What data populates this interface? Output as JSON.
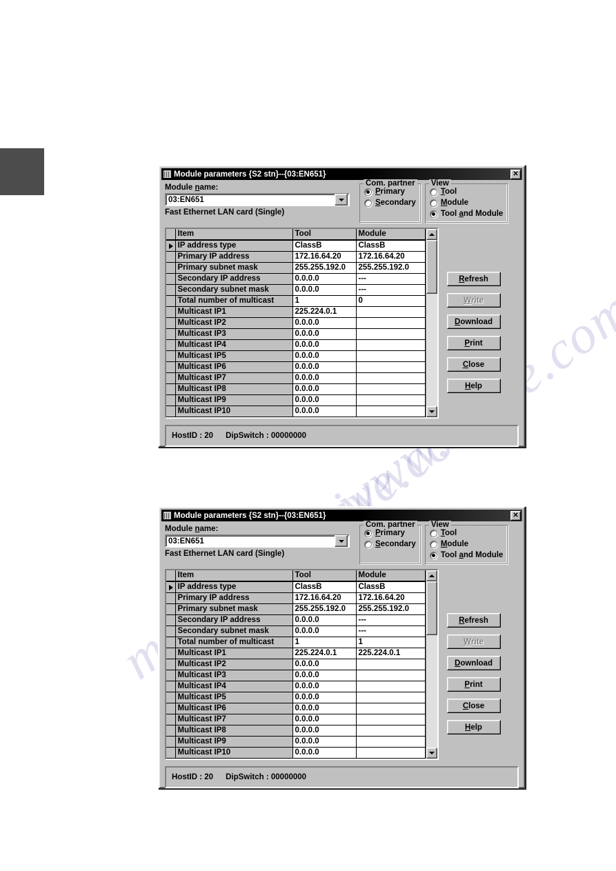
{
  "dialogs": [
    {
      "title": "Module parameters {S2 stn}--{03:EN651}",
      "close_label": "✕",
      "module_name_label": "Module name:",
      "module_name_value": "03:EN651",
      "module_caption": "Fast Ethernet LAN card (Single)",
      "com_partner": {
        "title": "Com. partner",
        "options": [
          "Primary",
          "Secondary"
        ],
        "selected": "Primary"
      },
      "view": {
        "title": "View",
        "options": [
          "Tool",
          "Module",
          "Tool and Module"
        ],
        "selected": "Tool and Module"
      },
      "grid": {
        "columns": [
          "Item",
          "Tool",
          "Module"
        ],
        "selected_row": 0,
        "rows": [
          {
            "item": "IP address type",
            "tool": "ClassB",
            "module": "ClassB"
          },
          {
            "item": "Primary IP address",
            "tool": "172.16.64.20",
            "module": "172.16.64.20"
          },
          {
            "item": "Primary subnet mask",
            "tool": "255.255.192.0",
            "module": "255.255.192.0"
          },
          {
            "item": "Secondary IP address",
            "tool": "0.0.0.0",
            "module": "---"
          },
          {
            "item": "Secondary subnet mask",
            "tool": "0.0.0.0",
            "module": "---"
          },
          {
            "item": "Total number of multicast",
            "tool": "1",
            "module": "0"
          },
          {
            "item": "Multicast IP1",
            "tool": "225.224.0.1",
            "module": ""
          },
          {
            "item": "Multicast IP2",
            "tool": "0.0.0.0",
            "module": ""
          },
          {
            "item": "Multicast IP3",
            "tool": "0.0.0.0",
            "module": ""
          },
          {
            "item": "Multicast IP4",
            "tool": "0.0.0.0",
            "module": ""
          },
          {
            "item": "Multicast IP5",
            "tool": "0.0.0.0",
            "module": ""
          },
          {
            "item": "Multicast IP6",
            "tool": "0.0.0.0",
            "module": ""
          },
          {
            "item": "Multicast IP7",
            "tool": "0.0.0.0",
            "module": ""
          },
          {
            "item": "Multicast IP8",
            "tool": "0.0.0.0",
            "module": ""
          },
          {
            "item": "Multicast IP9",
            "tool": "0.0.0.0",
            "module": ""
          },
          {
            "item": "Multicast IP10",
            "tool": "0.0.0.0",
            "module": ""
          }
        ]
      },
      "buttons": [
        {
          "label": "Refresh",
          "enabled": true
        },
        {
          "label": "Write",
          "enabled": false
        },
        {
          "label": "Download",
          "enabled": true
        },
        {
          "label": "Print",
          "enabled": true
        },
        {
          "label": "Close",
          "enabled": true
        },
        {
          "label": "Help",
          "enabled": true
        }
      ],
      "status": {
        "host_id": "HostID : 20",
        "dip_switch": "DipSwitch : 00000000"
      }
    },
    {
      "title": "Module parameters {S2 stn}--{03:EN651}",
      "close_label": "✕",
      "module_name_label": "Module name:",
      "module_name_value": "03:EN651",
      "module_caption": "Fast Ethernet LAN card (Single)",
      "com_partner": {
        "title": "Com. partner",
        "options": [
          "Primary",
          "Secondary"
        ],
        "selected": "Primary"
      },
      "view": {
        "title": "View",
        "options": [
          "Tool",
          "Module",
          "Tool and Module"
        ],
        "selected": "Tool and Module"
      },
      "grid": {
        "columns": [
          "Item",
          "Tool",
          "Module"
        ],
        "selected_row": 0,
        "rows": [
          {
            "item": "IP address type",
            "tool": "ClassB",
            "module": "ClassB"
          },
          {
            "item": "Primary IP address",
            "tool": "172.16.64.20",
            "module": "172.16.64.20"
          },
          {
            "item": "Primary subnet mask",
            "tool": "255.255.192.0",
            "module": "255.255.192.0"
          },
          {
            "item": "Secondary IP address",
            "tool": "0.0.0.0",
            "module": "---"
          },
          {
            "item": "Secondary subnet mask",
            "tool": "0.0.0.0",
            "module": "---"
          },
          {
            "item": "Total number of multicast",
            "tool": "1",
            "module": "1"
          },
          {
            "item": "Multicast IP1",
            "tool": "225.224.0.1",
            "module": "225.224.0.1"
          },
          {
            "item": "Multicast IP2",
            "tool": "0.0.0.0",
            "module": ""
          },
          {
            "item": "Multicast IP3",
            "tool": "0.0.0.0",
            "module": ""
          },
          {
            "item": "Multicast IP4",
            "tool": "0.0.0.0",
            "module": ""
          },
          {
            "item": "Multicast IP5",
            "tool": "0.0.0.0",
            "module": ""
          },
          {
            "item": "Multicast IP6",
            "tool": "0.0.0.0",
            "module": ""
          },
          {
            "item": "Multicast IP7",
            "tool": "0.0.0.0",
            "module": ""
          },
          {
            "item": "Multicast IP8",
            "tool": "0.0.0.0",
            "module": ""
          },
          {
            "item": "Multicast IP9",
            "tool": "0.0.0.0",
            "module": ""
          },
          {
            "item": "Multicast IP10",
            "tool": "0.0.0.0",
            "module": ""
          }
        ]
      },
      "buttons": [
        {
          "label": "Refresh",
          "enabled": true
        },
        {
          "label": "Write",
          "enabled": false
        },
        {
          "label": "Download",
          "enabled": true
        },
        {
          "label": "Print",
          "enabled": true
        },
        {
          "label": "Close",
          "enabled": true
        },
        {
          "label": "Help",
          "enabled": true
        }
      ],
      "status": {
        "host_id": "HostID : 20",
        "dip_switch": "DipSwitch : 00000000"
      }
    }
  ],
  "watermark": {
    "line1": "material.shive.com",
    "line2": "www.shive.com"
  },
  "colors": {
    "window_face": "#c0c0c0",
    "title_bar": "#000000",
    "grid_field": "#ffffff",
    "disabled_text": "#808080",
    "page_tab": "#4c4c4c"
  }
}
